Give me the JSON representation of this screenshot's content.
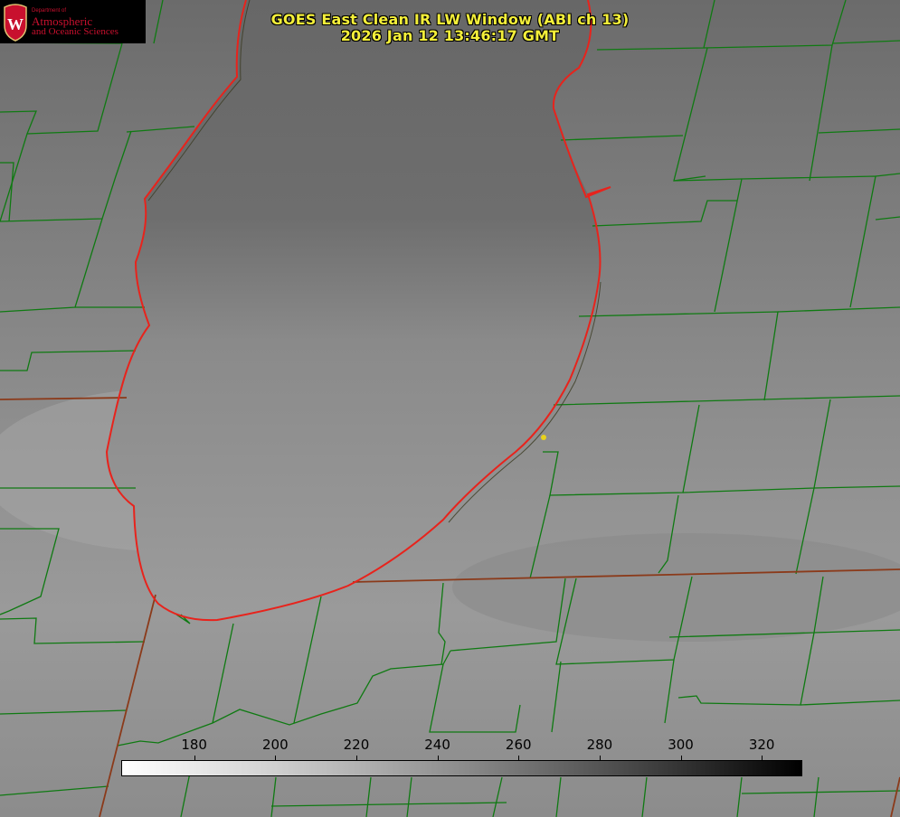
{
  "title": {
    "line1": "GOES East Clean IR LW Window (ABI ch 13)",
    "line2": "2026 Jan 12 13:46:17 GMT"
  },
  "logo": {
    "department": "Department of",
    "name_line1": "Atmospheric",
    "name_line2": "and Oceanic Sciences",
    "seal_letter": "W"
  },
  "colorbar": {
    "ticks": [
      180,
      200,
      220,
      240,
      260,
      280,
      300,
      320
    ],
    "min": 162,
    "max": 330
  },
  "colors": {
    "title": "#f4ef3a",
    "coastline": "#e8231c",
    "county_lines": "#0f7a12",
    "state_lines": "#8b3a1a",
    "marker": "#e8d21c"
  }
}
